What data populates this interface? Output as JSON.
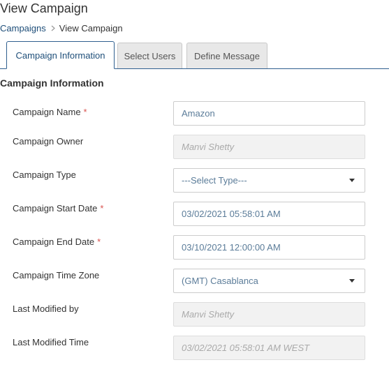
{
  "page": {
    "title": "View Campaign",
    "breadcrumb": {
      "link": "Campaigns",
      "current": "View Campaign"
    }
  },
  "tabs": [
    {
      "label": "Campaign Information",
      "active": true
    },
    {
      "label": "Select Users",
      "active": false
    },
    {
      "label": "Define Message",
      "active": false
    }
  ],
  "section": {
    "title": "Campaign Information"
  },
  "fields": {
    "campaign_name": {
      "label": "Campaign Name",
      "value": "Amazon",
      "required": true
    },
    "campaign_owner": {
      "label": "Campaign Owner",
      "value": "Manvi Shetty",
      "readonly": true
    },
    "campaign_type": {
      "label": "Campaign Type",
      "value": "---Select Type---",
      "type": "select"
    },
    "start_date": {
      "label": "Campaign Start Date",
      "value": "03/02/2021 05:58:01 AM",
      "required": true
    },
    "end_date": {
      "label": "Campaign End Date",
      "value": "03/10/2021 12:00:00 AM",
      "required": true
    },
    "time_zone": {
      "label": "Campaign Time Zone",
      "value": "(GMT) Casablanca",
      "type": "select"
    },
    "last_modified_by": {
      "label": "Last Modified by",
      "value": "Manvi Shetty",
      "readonly": true
    },
    "last_modified_time": {
      "label": "Last Modified Time",
      "value": "03/02/2021 05:58:01 AM WEST",
      "readonly": true
    }
  },
  "required_marker": "*",
  "colors": {
    "link": "#1e4e79",
    "required": "#d9534f",
    "tab_border": "#2f5f8f",
    "input_text": "#5b7c99"
  }
}
